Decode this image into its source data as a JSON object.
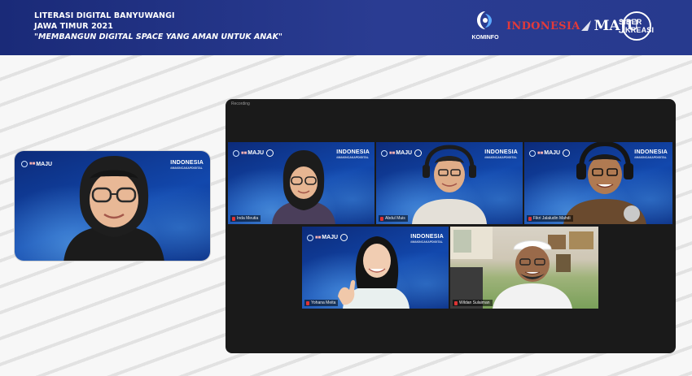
{
  "banner": {
    "line1": "LITERASI DIGITAL BANYUWANGI",
    "line2": "JAWA TIMUR 2021",
    "line3": "\"MEMBANGUN DIGITAL SPACE YANG AMAN UNTUK ANAK\""
  },
  "logos": {
    "kominfo": "KOMINFO",
    "indonesia": "INDONESIA",
    "maju": "MAJU",
    "siber_line1": "SIBER",
    "siber_line2": "KREASI"
  },
  "speaker": {
    "logo_word": "MAJU",
    "badge": "INDONESIA",
    "badge_sub": "#MAKINCAKAPDIGITAL"
  },
  "zoom": {
    "recording_label": "Recording",
    "tiles": [
      {
        "name": "Inda Meutia",
        "badge": "INDONESIA",
        "badge_sub": "#MAKINCAKAPDIGITAL",
        "logo_word": "MAJU"
      },
      {
        "name": "Abdul Muis",
        "badge": "INDONESIA",
        "badge_sub": "#MAKINCAKAPDIGITAL",
        "logo_word": "MAJU"
      },
      {
        "name": "Fikri Jalaludin Mahdi",
        "badge": "INDONESIA",
        "badge_sub": "#MAKINCAKAPDIGITAL",
        "logo_word": "MAJU"
      },
      {
        "name": "Yohana Meita",
        "badge": "INDONESIA",
        "badge_sub": "#MAKINCAKAPDIGITAL",
        "logo_word": "MAJU"
      },
      {
        "name": "Wildan Sulaiman"
      }
    ]
  },
  "colors": {
    "banner": "#1a2a78",
    "accent_red": "#e23a3a",
    "zoom_bg": "#1a1a1a"
  }
}
